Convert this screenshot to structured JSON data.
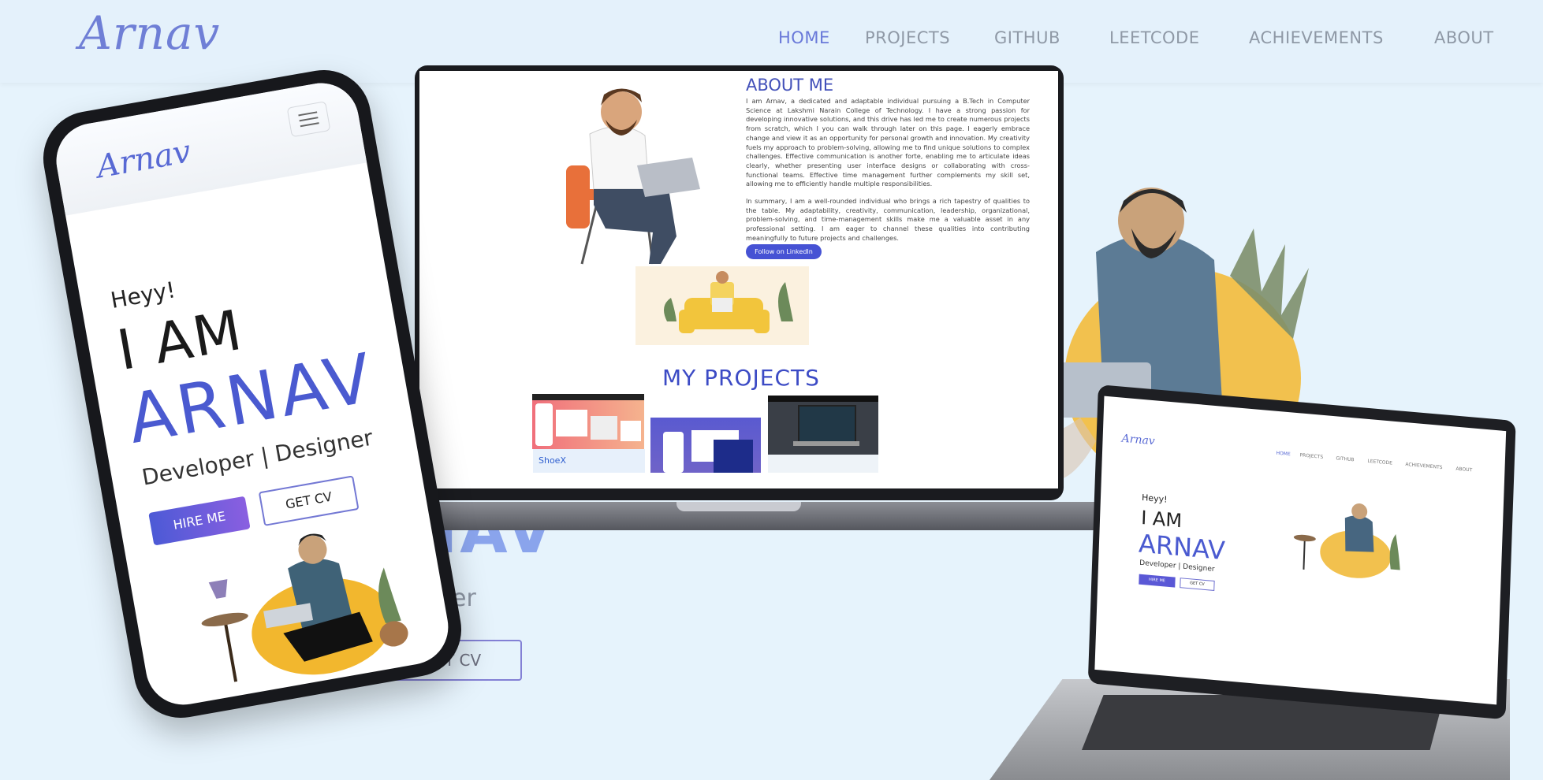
{
  "header": {
    "logo": "Arnav",
    "nav": [
      {
        "label": "HOME",
        "active": true
      },
      {
        "label": "PROJECTS",
        "active": false
      },
      {
        "label": "GITHUB",
        "active": false
      },
      {
        "label": "LEETCODE",
        "active": false
      },
      {
        "label": "ACHIEVEMENTS",
        "active": false
      },
      {
        "label": "ABOUT",
        "active": false
      }
    ]
  },
  "background_hero": {
    "name_partial": "NAV",
    "subtitle_partial": "gner",
    "get_cv": "GET CV"
  },
  "phone": {
    "logo": "Arnav",
    "greeting": "Heyy!",
    "i_am": "I AM",
    "name": "ARNAV",
    "role": "Developer | Designer",
    "hire_me": "HIRE ME",
    "get_cv": "GET CV"
  },
  "laptop": {
    "about_title": "ABOUT ME",
    "about_p1": "I am Arnav, a dedicated and adaptable individual pursuing a B.Tech in Computer Science at Lakshmi Narain College of Technology. I have a strong passion for developing innovative solutions, and this drive has led me to create numerous projects from scratch, which I you can walk through later on this page. I eagerly embrace change and view it as an opportunity for personal growth and innovation. My creativity fuels my approach to problem-solving, allowing me to find unique solutions to complex challenges. Effective communication is another forte, enabling me to articulate ideas clearly, whether presenting user interface designs or collaborating with cross-functional teams. Effective time management further complements my skill set, allowing me to efficiently handle multiple responsibilities.",
    "about_p2": "In summary, I am a well-rounded individual who brings a rich tapestry of qualities to the table. My adaptability, creativity, communication, leadership, organizational, problem-solving, and time-management skills make me a valuable asset in any professional setting. I am eager to channel these qualities into contributing meaningfully to future projects and challenges.",
    "linkedin_button": "Follow on LinkedIn",
    "projects_title": "MY PROJECTS",
    "project1_name": "ShoeX"
  },
  "laptop2": {
    "logo": "Arnav",
    "nav": [
      "HOME",
      "PROJECTS",
      "GITHUB",
      "LEETCODE",
      "ACHIEVEMENTS",
      "ABOUT"
    ],
    "greeting": "Heyy!",
    "i_am": "I AM",
    "name": "ARNAV",
    "role": "Developer | Designer",
    "hire_me": "HIRE ME",
    "get_cv": "GET CV"
  },
  "colors": {
    "background": "#e6f3fc",
    "accent": "#4a5ad0",
    "nav_active": "#6979d9",
    "nav_inactive": "#8f99a6"
  }
}
